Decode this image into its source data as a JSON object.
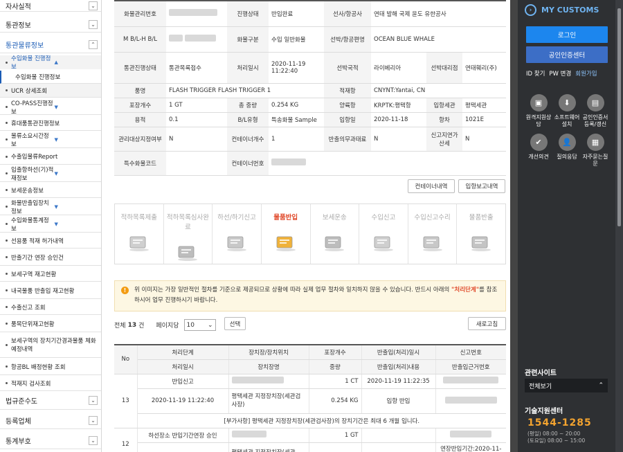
{
  "left_nav": {
    "items": [
      {
        "label": "자사실적",
        "type": "top"
      },
      {
        "label": "통관정보",
        "type": "top"
      },
      {
        "label": "통관물류정보",
        "type": "top-active"
      },
      {
        "label": "수입화물 진행정보",
        "type": "sub-active"
      },
      {
        "label": "수입화물 진행정보",
        "type": "sub-leaf"
      },
      {
        "label": "UCR 상세조회",
        "type": "sub"
      },
      {
        "label": "CO-PASS진행정보",
        "type": "sub"
      },
      {
        "label": "휴대품통관진행정보",
        "type": "sub"
      },
      {
        "label": "물류소요시간정보",
        "type": "sub"
      },
      {
        "label": "수출입물류Report",
        "type": "sub"
      },
      {
        "label": "입출항하선(기)적재정보",
        "type": "sub"
      },
      {
        "label": "보세운송정보",
        "type": "sub"
      },
      {
        "label": "화물반출입장치정보",
        "type": "sub"
      },
      {
        "label": "수입화물통계정보",
        "type": "sub"
      },
      {
        "label": "선용품 적재 허가내역",
        "type": "sub"
      },
      {
        "label": "반출기간 연장 승인건",
        "type": "sub"
      },
      {
        "label": "보세구역 재고현황",
        "type": "sub"
      },
      {
        "label": "내국물품 반출입 재고현황",
        "type": "sub"
      },
      {
        "label": "수출신고 조회",
        "type": "sub"
      },
      {
        "label": "품목단위재고현황",
        "type": "sub"
      },
      {
        "label": "보세구역의 장치기간경과물품 체화 예정내역",
        "type": "sub"
      },
      {
        "label": "항공BL 배정현황 조회",
        "type": "sub"
      },
      {
        "label": "적재지 검사조회",
        "type": "sub"
      },
      {
        "label": "법규준수도",
        "type": "top"
      },
      {
        "label": "등록업체",
        "type": "top"
      },
      {
        "label": "통계부호",
        "type": "top"
      }
    ]
  },
  "info": {
    "mgmt_no_label": "화물관리번호",
    "status_label": "진행상태",
    "status_value": "반입완료",
    "carrier_label": "선사/항공사",
    "carrier_value": "연태 발해 국제 윤도 유한공사",
    "mbl_label": "M B/L-H B/L",
    "cargo_type_label": "화물구분",
    "cargo_type_value": "수입 일반화물",
    "vessel_label": "선박/항공편명",
    "vessel_value": "OCEAN BLUE WHALE",
    "customs_status_label": "통관진행상태",
    "customs_status_value": "통관목록접수",
    "processed_label": "처리일시",
    "processed_value": "2020-11-19 11:22:40",
    "nationality_label": "선박국적",
    "nationality_value": "라이베리아",
    "agent_label": "선박대리점",
    "agent_value": "연태훼리(주)",
    "item_label": "품명",
    "item_value": "FLASH TRIGGER FLASH TRIGGER 1",
    "loading_port_label": "적재항",
    "loading_port_value": "CNYNT:Yantai, CN",
    "pkg_label": "포장개수",
    "pkg_value": "1 GT",
    "weight_label": "총 중량",
    "weight_value": "0.254 KG",
    "unload_port_label": "양륙항",
    "unload_port_value": "KRPTK:평택항",
    "entry_customs_label": "입항세관",
    "entry_customs_value": "평택세관",
    "volume_label": "용적",
    "volume_value": "0.1",
    "bl_type_label": "B/L유형",
    "bl_type_value": "특송화물 Sample",
    "entry_date_label": "입항일",
    "entry_date_value": "2020-11-18",
    "voyage_label": "항차",
    "voyage_value": "1021E",
    "managed_label": "관리대상지정여부",
    "managed_value": "N",
    "container_count_label": "컨테이너개수",
    "container_count_value": "1",
    "obligation_label": "반출의무과태료",
    "obligation_value": "N",
    "late_report_label": "신고지연가산세",
    "late_report_value": "N",
    "special_code_label": "특수화물코드",
    "container_no_label": "컨테이너번호"
  },
  "buttons": {
    "container_history": "컨테이너내역",
    "entry_report": "입항보고내역",
    "select": "선택",
    "refresh": "새로고침"
  },
  "steps": [
    {
      "label": "적하목록제출",
      "active": false,
      "icon": "clipboard-icon"
    },
    {
      "label": "적하목록심사완료",
      "active": false,
      "icon": "stamp-icon"
    },
    {
      "label": "하선/하기신고",
      "active": false,
      "icon": "document-pen-icon"
    },
    {
      "label": "물품반입",
      "active": true,
      "icon": "boxes-icon"
    },
    {
      "label": "보세운송",
      "active": false,
      "icon": "truck-icon"
    },
    {
      "label": "수입신고",
      "active": false,
      "icon": "report-icon"
    },
    {
      "label": "수입신고수리",
      "active": false,
      "icon": "report-approved-icon"
    },
    {
      "label": "물품반출",
      "active": false,
      "icon": "release-icon"
    }
  ],
  "notice": {
    "line1": "위 이미지는 가장 일반적인 절차를 기준으로 제공되므로 상황에 따라 실제 업무 절차와 일치하지 않을 수 있습니다. 반드시 아래의",
    "highlight": "\"처리단계\"",
    "line2": "를 참조하시어 업무 진행하시기 바랍니다."
  },
  "listbar": {
    "total_prefix": "전체",
    "total_count": "13",
    "total_suffix": "건",
    "page_size_label": "페이지당",
    "page_size": "10"
  },
  "table": {
    "headers_row1": [
      "No",
      "처리단계",
      "장치장/장치위치",
      "포장개수",
      "반출입(처리)일시",
      "신고번호"
    ],
    "headers_row2": [
      "처리일시",
      "장치장명",
      "중량",
      "반출입(처리)내용",
      "반출입근거번호"
    ],
    "row13": {
      "no": "13",
      "stage": "반입신고",
      "pkg": "1 CT",
      "inout_datetime": "2020-11-19 11:22:35",
      "processed": "2020-11-19 11:22:40",
      "warehouse": "평택세관 지정장치장(세관검사장)",
      "weight": "0.254 KG",
      "content": "입항 반입",
      "note": "[부가사항] 평택세관 지정장치장(세관검사장)의 장치기간은 최대 6 개월 입니다."
    },
    "row12": {
      "no": "12",
      "stage": "하선장소 반입기간연장 승인",
      "pkg": "1 GT",
      "warehouse": "평택세관 지정장치장(세관",
      "basis": "연장반입기간:2020-11-3"
    }
  },
  "right_panel": {
    "title": "MY CUSTOMS",
    "login": "로그인",
    "cert_center": "공인인증센터",
    "links": [
      "ID 찾기",
      "PW 변경",
      "회원가입"
    ],
    "icons": [
      {
        "label": "원격지원상담",
        "icon": "remote-support-icon"
      },
      {
        "label": "소프트웨어설치",
        "icon": "software-install-icon"
      },
      {
        "label": "공인인증서등록/갱신",
        "icon": "certificate-icon"
      },
      {
        "label": "개선의견",
        "icon": "feedback-icon"
      },
      {
        "label": "질의응답",
        "icon": "qna-icon"
      },
      {
        "label": "자주묻는질문",
        "icon": "faq-icon"
      }
    ],
    "related_title": "관련사이트",
    "related_select": "전체보기",
    "support_title": "기술지원센터",
    "phone": "1544-1285",
    "hours_line1": "(평일) 08:00 ~ 20:00",
    "hours_line2": "(토요일) 08:00 ~ 15:00"
  },
  "colors": {
    "accent": "#1c86ee",
    "active_step": "#e04a2b",
    "nav_blue": "#1a5bb5",
    "panel": "#2e3033"
  }
}
